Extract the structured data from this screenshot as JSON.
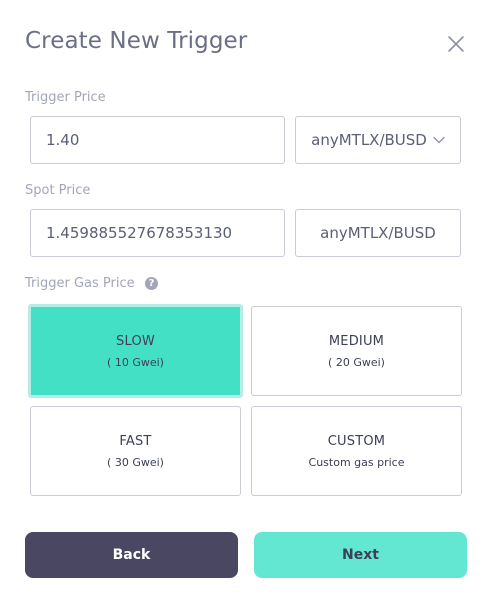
{
  "dialog": {
    "title": "Create New Trigger"
  },
  "trigger_price": {
    "label": "Trigger Price",
    "value": "1.40",
    "pair": "anyMTLX/BUSD"
  },
  "spot_price": {
    "label": "Spot Price",
    "value": "1.459885527678353130",
    "pair": "anyMTLX/BUSD"
  },
  "gas_price": {
    "label": "Trigger Gas Price",
    "help_icon": "?",
    "options": [
      {
        "name": "SLOW",
        "detail": "( 10 Gwei)",
        "selected": true
      },
      {
        "name": "MEDIUM",
        "detail": "( 20 Gwei)",
        "selected": false
      },
      {
        "name": "FAST",
        "detail": "( 30 Gwei)",
        "selected": false
      },
      {
        "name": "CUSTOM",
        "detail": "Custom gas price",
        "selected": false
      }
    ]
  },
  "actions": {
    "back_label": "Back",
    "next_label": "Next"
  },
  "colors": {
    "accent": "#43e0c6",
    "back_button": "#4a4762",
    "next_button": "#63e6d2"
  },
  "icons": {
    "close": "close-icon",
    "dropdown": "chevron-down-icon",
    "help": "help-circle-icon"
  }
}
